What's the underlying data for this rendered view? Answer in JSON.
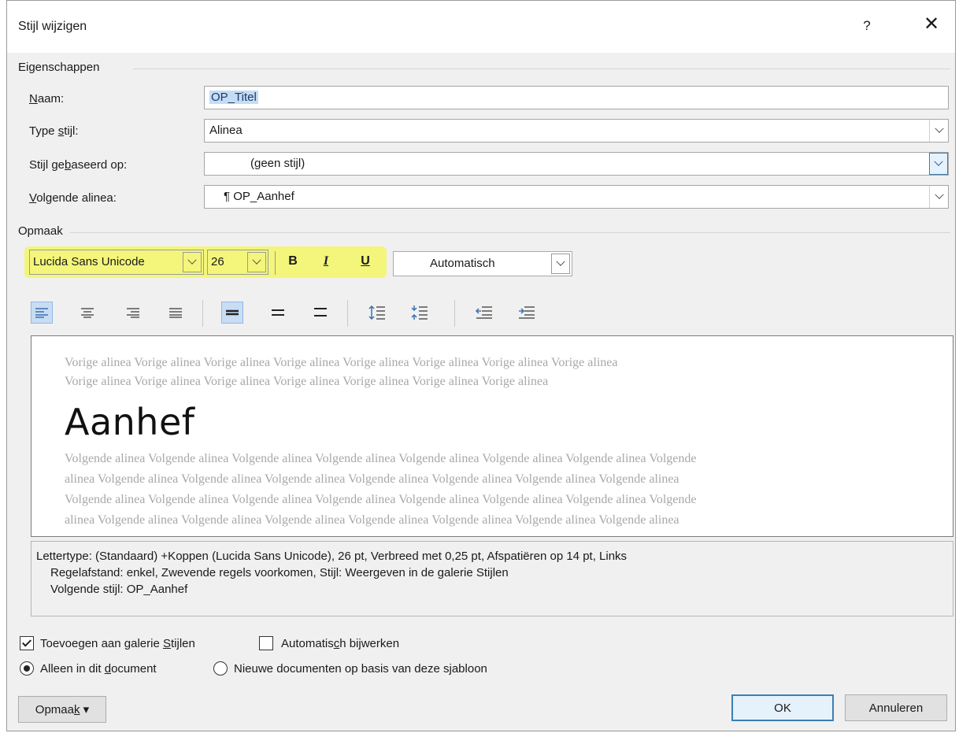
{
  "window": {
    "title": "Stijl wijzigen",
    "help": "?",
    "close": "✕"
  },
  "properties": {
    "section": "Eigenschappen",
    "name_label": "Naam:",
    "name_value": "OP_Titel",
    "type_label": "Type stijl:",
    "type_value": "Alinea",
    "based_label": "Stijl gebaseerd op:",
    "based_value": "(geen stijl)",
    "next_label": "Volgende alinea:",
    "next_value": "¶ OP_Aanhef"
  },
  "formatting": {
    "section": "Opmaak",
    "font": "Lucida Sans Unicode",
    "size": "26",
    "bold": "B",
    "italic": "I",
    "underline": "U",
    "color": "Automatisch",
    "highlight_color": "#f3f67a"
  },
  "toolbar_icons": [
    "align-left-icon",
    "align-center-icon",
    "align-right-icon",
    "justify-icon",
    "single-spacing-icon",
    "one-half-spacing-icon",
    "double-spacing-icon",
    "increase-paragraph-spacing-icon",
    "decrease-paragraph-spacing-icon",
    "decrease-indent-icon",
    "increase-indent-icon"
  ],
  "preview": {
    "prev_line1": "Vorige alinea Vorige alinea Vorige alinea Vorige alinea Vorige alinea Vorige alinea Vorige alinea Vorige alinea",
    "prev_line2": "Vorige alinea Vorige alinea Vorige alinea Vorige alinea Vorige alinea Vorige alinea Vorige alinea",
    "main": "Aanhef",
    "next_line1": "Volgende alinea Volgende alinea Volgende alinea Volgende alinea Volgende alinea Volgende alinea Volgende alinea Volgende",
    "next_line2": "alinea Volgende alinea Volgende alinea Volgende alinea Volgende alinea Volgende alinea Volgende alinea Volgende alinea",
    "next_line3": "Volgende alinea Volgende alinea Volgende alinea Volgende alinea Volgende alinea Volgende alinea Volgende alinea Volgende",
    "next_line4": "alinea Volgende alinea Volgende alinea Volgende alinea Volgende alinea Volgende alinea Volgende alinea Volgende alinea"
  },
  "description": {
    "line1": "Lettertype: (Standaard) +Koppen (Lucida Sans Unicode), 26 pt, Verbreed met  0,25 pt, Afspatiëren op 14 pt, Links",
    "line2": "Regelafstand:  enkel, Zwevende regels voorkomen, Stijl: Weergeven in de galerie Stijlen",
    "line3": "Volgende stijl: OP_Aanhef"
  },
  "options": {
    "add_gallery": "Toevoegen aan galerie Stijlen",
    "add_gallery_checked": true,
    "auto_update": "Automatisch bijwerken",
    "auto_update_checked": false,
    "only_document": "Alleen in dit document",
    "new_documents": "Nieuwe documenten op basis van deze sjabloon",
    "selected_scope": "only_document"
  },
  "buttons": {
    "format": "Opmaak",
    "ok": "OK",
    "cancel": "Annuleren"
  }
}
